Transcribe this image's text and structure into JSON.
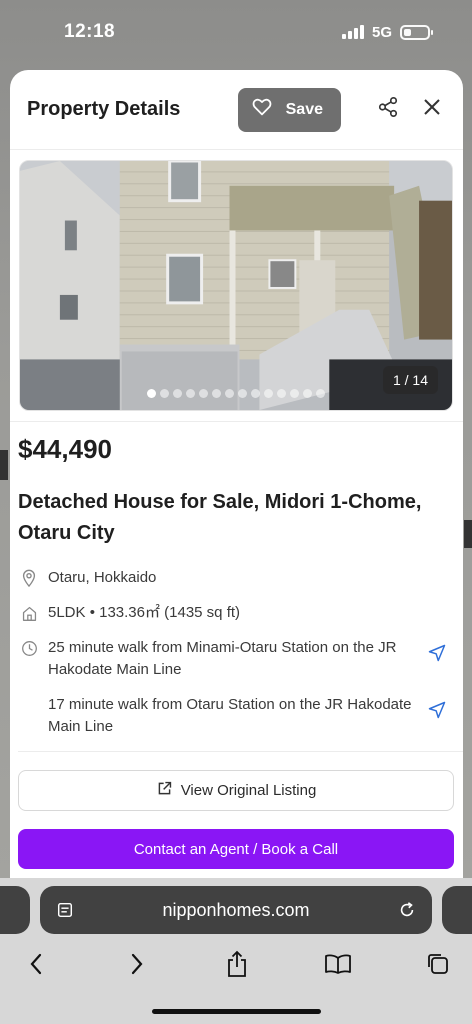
{
  "status_bar": {
    "time": "12:18",
    "network": "5G"
  },
  "modal": {
    "title": "Property Details",
    "save_label": "Save",
    "photo": {
      "counter": "1 / 14",
      "total": 14,
      "current": 1
    },
    "price": "$44,490",
    "listing_title": "Detached House for Sale, Midori 1-Chome, Otaru City",
    "location": "Otaru, Hokkaido",
    "layout": "5LDK • 133.36㎡ (1435 sq ft)",
    "transit": [
      "25 minute walk from Minami-Otaru Station on the JR Hakodate Main Line",
      "17 minute walk from Otaru Station on the JR Hakodate Main Line"
    ],
    "view_listing_label": "View Original Listing",
    "contact_label": "Contact an Agent / Book a Call",
    "accent_color": "#8a16f5"
  },
  "browser": {
    "url": "nipponhomes.com"
  },
  "icons": {
    "save": "heart-icon",
    "share": "share-icon",
    "close": "close-icon",
    "location": "pin-icon",
    "layout": "home-icon",
    "transit": "clock-icon",
    "directions": "navigation-arrow-icon",
    "external": "external-link-icon",
    "reader": "reader-icon",
    "reload": "reload-icon",
    "back": "chevron-left-icon",
    "forward": "chevron-right-icon",
    "share_sheet": "share-icon",
    "bookmarks": "book-icon",
    "tabs": "tabs-icon"
  }
}
